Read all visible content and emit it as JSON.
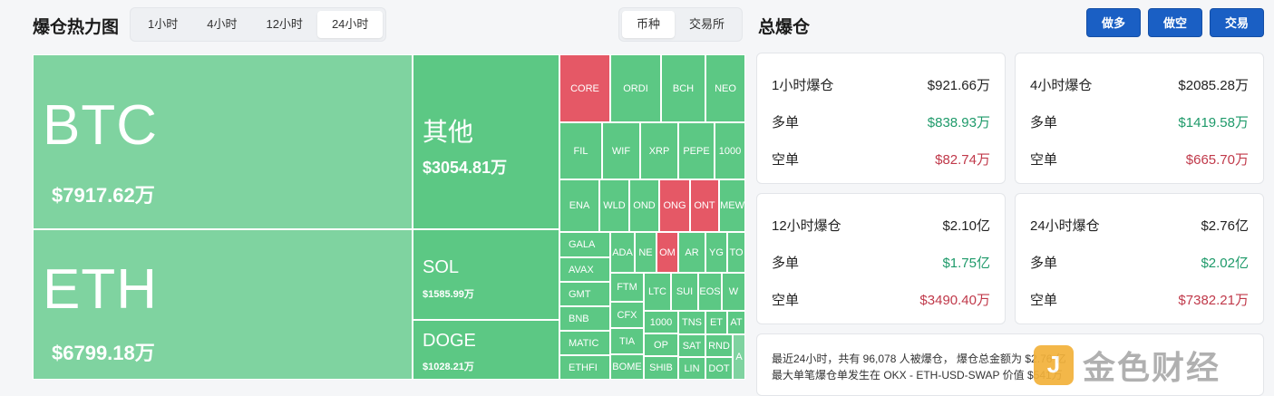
{
  "heatmap": {
    "title": "爆仓热力图",
    "time_tabs": [
      "1小时",
      "4小时",
      "12小时",
      "24小时"
    ],
    "active_time_tab": "24小时",
    "group_tabs": [
      "币种",
      "交易所"
    ],
    "active_group_tab": "币种",
    "btc": {
      "symbol": "BTC",
      "value": "$7917.62万"
    },
    "eth": {
      "symbol": "ETH",
      "value": "$6799.18万"
    },
    "other": {
      "symbol": "其他",
      "value": "$3054.81万"
    },
    "sol": {
      "symbol": "SOL",
      "value": "$1585.99万"
    },
    "doge": {
      "symbol": "DOGE",
      "value": "$1028.21万"
    },
    "small_tiles": [
      "CORE",
      "ORDI",
      "BCH",
      "NEO",
      "FIL",
      "WIF",
      "XRP",
      "PEPE",
      "1000",
      "ENA",
      "WLD",
      "OND",
      "ONG",
      "ONT",
      "MEW",
      "GALA",
      "AVAX",
      "GMT",
      "BNB",
      "MATIC",
      "ETHFI",
      "ADA",
      "NE",
      "OM",
      "AR",
      "YG",
      "TO",
      "FTM",
      "CFX",
      "TIA",
      "BOME",
      "LTC",
      "SUI",
      "EOS",
      "W",
      "1000",
      "OP",
      "SHIB",
      "TNS",
      "ET",
      "AT",
      "SAT",
      "RND",
      "LIN",
      "DOT",
      "A"
    ]
  },
  "total": {
    "title": "总爆仓",
    "buttons": {
      "long": "做多",
      "short": "做空",
      "trade": "交易"
    },
    "cards": [
      {
        "label": "1小时爆仓",
        "total": "$921.66万",
        "long_label": "多单",
        "long": "$838.93万",
        "short_label": "空单",
        "short": "$82.74万"
      },
      {
        "label": "4小时爆仓",
        "total": "$2085.28万",
        "long_label": "多单",
        "long": "$1419.58万",
        "short_label": "空单",
        "short": "$665.70万"
      },
      {
        "label": "12小时爆仓",
        "total": "$2.10亿",
        "long_label": "多单",
        "long": "$1.75亿",
        "short_label": "空单",
        "short": "$3490.40万"
      },
      {
        "label": "24小时爆仓",
        "total": "$2.76亿",
        "long_label": "多单",
        "long": "$2.02亿",
        "short_label": "空单",
        "short": "$7382.21万"
      }
    ],
    "summary_line1": "最近24小时，共有 96,078 人被爆仓， 爆仓总金额为 $2.76 亿",
    "summary_line2": "最大单笔爆仓单发生在 OKX - ETH-USD-SWAP 价值 $541万"
  },
  "watermark": {
    "logo_char": "J",
    "text": "金色财经"
  }
}
